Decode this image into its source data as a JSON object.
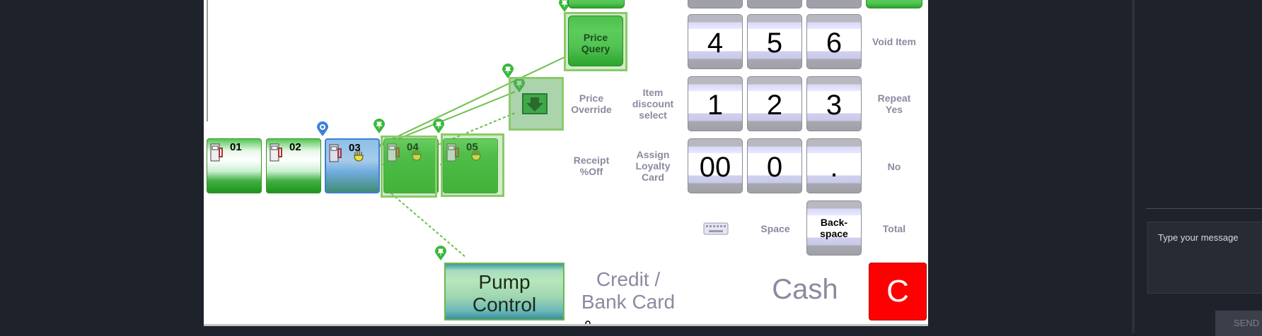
{
  "pumps": [
    {
      "num": "01"
    },
    {
      "num": "02"
    },
    {
      "num": "03"
    },
    {
      "num": "04"
    },
    {
      "num": "05"
    }
  ],
  "functions": {
    "price_query": "Price\nQuery",
    "price_override": "Price\nOverride",
    "item_discount": "Item\ndiscount\nselect",
    "receipt_off": "Receipt\n%Off",
    "assign_loyalty": "Assign\nLoyalty\nCard",
    "void_item": "Void Item",
    "repeat_yes": "Repeat\nYes",
    "no": "No",
    "space": "Space",
    "total": "Total",
    "backspace": "Back-\nspace"
  },
  "keypad": {
    "k4": "4",
    "k5": "5",
    "k6": "6",
    "k1": "1",
    "k2": "2",
    "k3": "3",
    "k00": "00",
    "k0": "0",
    "kdot": "."
  },
  "bottom": {
    "pump_control": "Pump\nControl",
    "credit": "Credit /\nBank Card",
    "cash": "Cash",
    "cancel": "C"
  },
  "chat": {
    "placeholder": "Type your message",
    "send": "SEND"
  },
  "colors": {
    "background": "#1e222b",
    "canvas": "#ffffff",
    "accent_green": "#2fb02f",
    "cancel_red": "#ff0000",
    "label_grey": "#8a8aa0"
  }
}
